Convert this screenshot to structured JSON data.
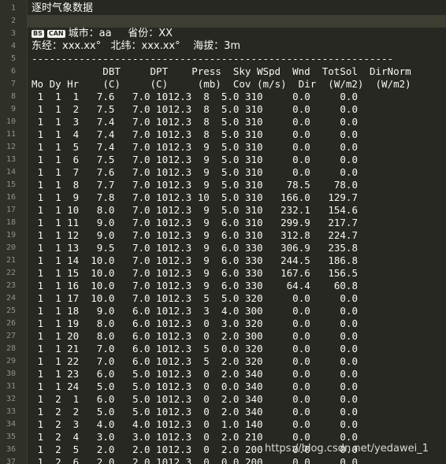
{
  "title": "逐时气象数据",
  "tags": [
    "BS",
    "CAN"
  ],
  "header": {
    "city_line_prefix": "城市：aa     省份：XX",
    "coords_line": "东经：xxx.xx°   北纬：xxx.xx°    海拔：3m"
  },
  "separator": "-------------------------------------------------------------",
  "column_header_1": "            DBT     DPT    Press  Sky WSpd  Wnd  TotSol  DirNorm",
  "column_header_2": "            (C)     (C)     (mb)  Cov (m/s)  Dir  (W/m2)  (W/m2)",
  "column_header_3": "Mo Dy Hr",
  "columns": [
    "Mo",
    "Dy",
    "Hr",
    "DBT (C)",
    "DPT (C)",
    "Press (mb)",
    "Sky Cov",
    "WSpd (m/s)",
    "Wnd Dir",
    "TotSol (W/m2)",
    "DirNorm (W/m2)"
  ],
  "rows": [
    [
      " 1  1  1",
      "   7.6",
      "   7.0",
      " 1012.3",
      "  8",
      "  5.0",
      " 310",
      "     0.0",
      "     0.0"
    ],
    [
      " 1  1  2",
      "   7.5",
      "   7.0",
      " 1012.3",
      "  8",
      "  5.0",
      " 310",
      "     0.0",
      "     0.0"
    ],
    [
      " 1  1  3",
      "   7.4",
      "   7.0",
      " 1012.3",
      "  8",
      "  5.0",
      " 310",
      "     0.0",
      "     0.0"
    ],
    [
      " 1  1  4",
      "   7.4",
      "   7.0",
      " 1012.3",
      "  8",
      "  5.0",
      " 310",
      "     0.0",
      "     0.0"
    ],
    [
      " 1  1  5",
      "   7.4",
      "   7.0",
      " 1012.3",
      "  9",
      "  5.0",
      " 310",
      "     0.0",
      "     0.0"
    ],
    [
      " 1  1  6",
      "   7.5",
      "   7.0",
      " 1012.3",
      "  9",
      "  5.0",
      " 310",
      "     0.0",
      "     0.0"
    ],
    [
      " 1  1  7",
      "   7.6",
      "   7.0",
      " 1012.3",
      "  9",
      "  5.0",
      " 310",
      "     0.0",
      "     0.0"
    ],
    [
      " 1  1  8",
      "   7.7",
      "   7.0",
      " 1012.3",
      "  9",
      "  5.0",
      " 310",
      "    78.5",
      "    78.0"
    ],
    [
      " 1  1  9",
      "   7.8",
      "   7.0",
      " 1012.3",
      " 10",
      "  5.0",
      " 310",
      "   166.0",
      "   129.7"
    ],
    [
      " 1  1 10",
      "   8.0",
      "   7.0",
      " 1012.3",
      "  9",
      "  5.0",
      " 310",
      "   232.1",
      "   154.6"
    ],
    [
      " 1  1 11",
      "   9.0",
      "   7.0",
      " 1012.3",
      "  9",
      "  6.0",
      " 310",
      "   299.9",
      "   217.7"
    ],
    [
      " 1  1 12",
      "   9.0",
      "   7.0",
      " 1012.3",
      "  9",
      "  6.0",
      " 310",
      "   312.8",
      "   224.7"
    ],
    [
      " 1  1 13",
      "   9.5",
      "   7.0",
      " 1012.3",
      "  9",
      "  6.0",
      " 330",
      "   306.9",
      "   235.8"
    ],
    [
      " 1  1 14",
      "  10.0",
      "   7.0",
      " 1012.3",
      "  9",
      "  6.0",
      " 330",
      "   244.5",
      "   186.8"
    ],
    [
      " 1  1 15",
      "  10.0",
      "   7.0",
      " 1012.3",
      "  9",
      "  6.0",
      " 330",
      "   167.6",
      "   156.5"
    ],
    [
      " 1  1 16",
      "  10.0",
      "   7.0",
      " 1012.3",
      "  9",
      "  6.0",
      " 330",
      "    64.4",
      "    60.8"
    ],
    [
      " 1  1 17",
      "  10.0",
      "   7.0",
      " 1012.3",
      "  5",
      "  5.0",
      " 320",
      "     0.0",
      "     0.0"
    ],
    [
      " 1  1 18",
      "   9.0",
      "   6.0",
      " 1012.3",
      "  3",
      "  4.0",
      " 300",
      "     0.0",
      "     0.0"
    ],
    [
      " 1  1 19",
      "   8.0",
      "   6.0",
      " 1012.3",
      "  0",
      "  3.0",
      " 320",
      "     0.0",
      "     0.0"
    ],
    [
      " 1  1 20",
      "   8.0",
      "   6.0",
      " 1012.3",
      "  0",
      "  2.0",
      " 300",
      "     0.0",
      "     0.0"
    ],
    [
      " 1  1 21",
      "   7.0",
      "   6.0",
      " 1012.3",
      "  5",
      "  0.0",
      " 320",
      "     0.0",
      "     0.0"
    ],
    [
      " 1  1 22",
      "   7.0",
      "   6.0",
      " 1012.3",
      "  5",
      "  2.0",
      " 320",
      "     0.0",
      "     0.0"
    ],
    [
      " 1  1 23",
      "   6.0",
      "   5.0",
      " 1012.3",
      "  0",
      "  2.0",
      " 340",
      "     0.0",
      "     0.0"
    ],
    [
      " 1  1 24",
      "   5.0",
      "   5.0",
      " 1012.3",
      "  0",
      "  0.0",
      " 340",
      "     0.0",
      "     0.0"
    ],
    [
      " 1  2  1",
      "   6.0",
      "   5.0",
      " 1012.3",
      "  0",
      "  2.0",
      " 340",
      "     0.0",
      "     0.0"
    ],
    [
      " 1  2  2",
      "   5.0",
      "   5.0",
      " 1012.3",
      "  0",
      "  2.0",
      " 340",
      "     0.0",
      "     0.0"
    ],
    [
      " 1  2  3",
      "   4.0",
      "   4.0",
      " 1012.3",
      "  0",
      "  1.0",
      " 140",
      "     0.0",
      "     0.0"
    ],
    [
      " 1  2  4",
      "   3.0",
      "   3.0",
      " 1012.3",
      "  0",
      "  2.0",
      " 210",
      "     0.0",
      "     0.0"
    ],
    [
      " 1  2  5",
      "   2.0",
      "   2.0",
      " 1012.3",
      "  0",
      "  2.0",
      " 200",
      "     0.0",
      "     0.0"
    ],
    [
      " 1  2  6",
      "   2.0",
      "   2.0",
      " 1012.3",
      "  0",
      "  0.0",
      " 200",
      "     0.0",
      "     0.0"
    ]
  ],
  "watermark": "https://blog.csdn.net/yedawei_1",
  "line_numbers": [
    "1",
    "2",
    "3",
    "4",
    "5",
    "6",
    "7",
    "8",
    "9",
    "10",
    "11",
    "12",
    "13",
    "14",
    "15",
    "16",
    "17",
    "18",
    "19",
    "20",
    "21",
    "22",
    "23",
    "24",
    "25",
    "26",
    "27",
    "28",
    "29",
    "30",
    "31",
    "32",
    "33",
    "34",
    "35",
    "36",
    "37"
  ],
  "colors": {
    "background": "#272822",
    "gutter": "#2f3129",
    "text": "#f8f8f2",
    "line_number": "#8f908a"
  }
}
